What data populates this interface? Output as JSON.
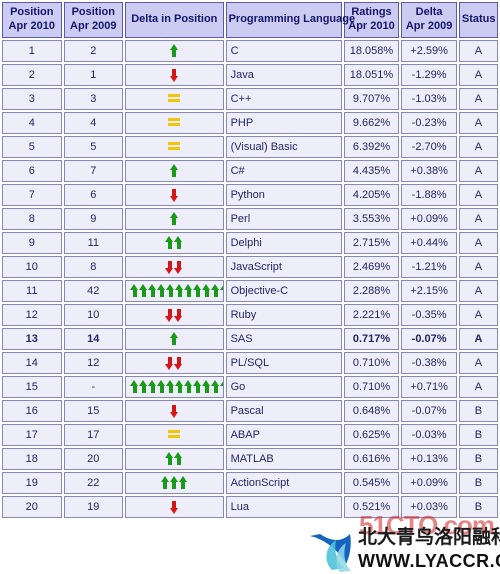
{
  "table": {
    "columns": [
      {
        "id": "pos2010",
        "line1": "Position",
        "line2": "Apr 2010",
        "width": "12.2%"
      },
      {
        "id": "pos2009",
        "line1": "Position",
        "line2": "Apr 2009",
        "width": "12.2%"
      },
      {
        "id": "delta",
        "line1": "Delta in Position",
        "line2": "",
        "width": "20.2%"
      },
      {
        "id": "lang",
        "line1": "Programming Language",
        "line2": "",
        "width": "23.8%"
      },
      {
        "id": "ratings",
        "line1": "Ratings",
        "line2": "Apr 2010",
        "width": "11.4%"
      },
      {
        "id": "dratio",
        "line1": "Delta",
        "line2": "Apr 2009",
        "width": "11.4%"
      },
      {
        "id": "status",
        "line1": "Status",
        "line2": "",
        "width": "8.0%"
      }
    ],
    "rows": [
      {
        "pos2010": "1",
        "pos2009": "2",
        "delta": {
          "dir": "up",
          "count": 1
        },
        "lang": "C",
        "ratings": "18.058%",
        "dratio": "+2.59%",
        "status": "A",
        "highlight": false
      },
      {
        "pos2010": "2",
        "pos2009": "1",
        "delta": {
          "dir": "down",
          "count": 1
        },
        "lang": "Java",
        "ratings": "18.051%",
        "dratio": "-1.29%",
        "status": "A",
        "highlight": false
      },
      {
        "pos2010": "3",
        "pos2009": "3",
        "delta": {
          "dir": "equal",
          "count": 1
        },
        "lang": "C++",
        "ratings": "9.707%",
        "dratio": "-1.03%",
        "status": "A",
        "highlight": false
      },
      {
        "pos2010": "4",
        "pos2009": "4",
        "delta": {
          "dir": "equal",
          "count": 1
        },
        "lang": "PHP",
        "ratings": "9.662%",
        "dratio": "-0.23%",
        "status": "A",
        "highlight": false
      },
      {
        "pos2010": "5",
        "pos2009": "5",
        "delta": {
          "dir": "equal",
          "count": 1
        },
        "lang": "(Visual) Basic",
        "ratings": "6.392%",
        "dratio": "-2.70%",
        "status": "A",
        "highlight": false
      },
      {
        "pos2010": "6",
        "pos2009": "7",
        "delta": {
          "dir": "up",
          "count": 1
        },
        "lang": "C#",
        "ratings": "4.435%",
        "dratio": "+0.38%",
        "status": "A",
        "highlight": false
      },
      {
        "pos2010": "7",
        "pos2009": "6",
        "delta": {
          "dir": "down",
          "count": 1
        },
        "lang": "Python",
        "ratings": "4.205%",
        "dratio": "-1.88%",
        "status": "A",
        "highlight": false
      },
      {
        "pos2010": "8",
        "pos2009": "9",
        "delta": {
          "dir": "up",
          "count": 1
        },
        "lang": "Perl",
        "ratings": "3.553%",
        "dratio": "+0.09%",
        "status": "A",
        "highlight": false
      },
      {
        "pos2010": "9",
        "pos2009": "11",
        "delta": {
          "dir": "up",
          "count": 2
        },
        "lang": "Delphi",
        "ratings": "2.715%",
        "dratio": "+0.44%",
        "status": "A",
        "highlight": false
      },
      {
        "pos2010": "10",
        "pos2009": "8",
        "delta": {
          "dir": "down",
          "count": 2
        },
        "lang": "JavaScript",
        "ratings": "2.469%",
        "dratio": "-1.21%",
        "status": "A",
        "highlight": false
      },
      {
        "pos2010": "11",
        "pos2009": "42",
        "delta": {
          "dir": "up",
          "count": 11
        },
        "lang": "Objective-C",
        "ratings": "2.288%",
        "dratio": "+2.15%",
        "status": "A",
        "highlight": false
      },
      {
        "pos2010": "12",
        "pos2009": "10",
        "delta": {
          "dir": "down",
          "count": 2
        },
        "lang": "Ruby",
        "ratings": "2.221%",
        "dratio": "-0.35%",
        "status": "A",
        "highlight": false
      },
      {
        "pos2010": "13",
        "pos2009": "14",
        "delta": {
          "dir": "up",
          "count": 1
        },
        "lang": "SAS",
        "ratings": "0.717%",
        "dratio": "-0.07%",
        "status": "A",
        "highlight": true
      },
      {
        "pos2010": "14",
        "pos2009": "12",
        "delta": {
          "dir": "down",
          "count": 2
        },
        "lang": "PL/SQL",
        "ratings": "0.710%",
        "dratio": "-0.38%",
        "status": "A",
        "highlight": false
      },
      {
        "pos2010": "15",
        "pos2009": "-",
        "delta": {
          "dir": "up",
          "count": 11
        },
        "lang": "Go",
        "ratings": "0.710%",
        "dratio": "+0.71%",
        "status": "A",
        "highlight": false
      },
      {
        "pos2010": "16",
        "pos2009": "15",
        "delta": {
          "dir": "down",
          "count": 1
        },
        "lang": "Pascal",
        "ratings": "0.648%",
        "dratio": "-0.07%",
        "status": "B",
        "highlight": false
      },
      {
        "pos2010": "17",
        "pos2009": "17",
        "delta": {
          "dir": "equal",
          "count": 1
        },
        "lang": "ABAP",
        "ratings": "0.625%",
        "dratio": "-0.03%",
        "status": "B",
        "highlight": false
      },
      {
        "pos2010": "18",
        "pos2009": "20",
        "delta": {
          "dir": "up",
          "count": 2
        },
        "lang": "MATLAB",
        "ratings": "0.616%",
        "dratio": "+0.13%",
        "status": "B",
        "highlight": false
      },
      {
        "pos2010": "19",
        "pos2009": "22",
        "delta": {
          "dir": "up",
          "count": 3
        },
        "lang": "ActionScript",
        "ratings": "0.545%",
        "dratio": "+0.09%",
        "status": "B",
        "highlight": false
      },
      {
        "pos2010": "20",
        "pos2009": "19",
        "delta": {
          "dir": "down",
          "count": 1
        },
        "lang": "Lua",
        "ratings": "0.521%",
        "dratio": "+0.03%",
        "status": "B",
        "highlight": false
      }
    ]
  },
  "watermarks": {
    "site_badge": "51CTO.com",
    "chinese_text": "北大青鸟洛阳融科",
    "url_text": "WWW.LYACCR.COM"
  },
  "colors": {
    "header_bg": "#ccccf2",
    "header_border": "#5b5ba5",
    "cell_bg": "#eeeef9",
    "cell_border": "#8888b8",
    "text": "#252565",
    "arrow_up": "#1a9a1a",
    "arrow_down": "#d41616",
    "equal": "#f2c40c",
    "badge_red": "#d02026"
  }
}
